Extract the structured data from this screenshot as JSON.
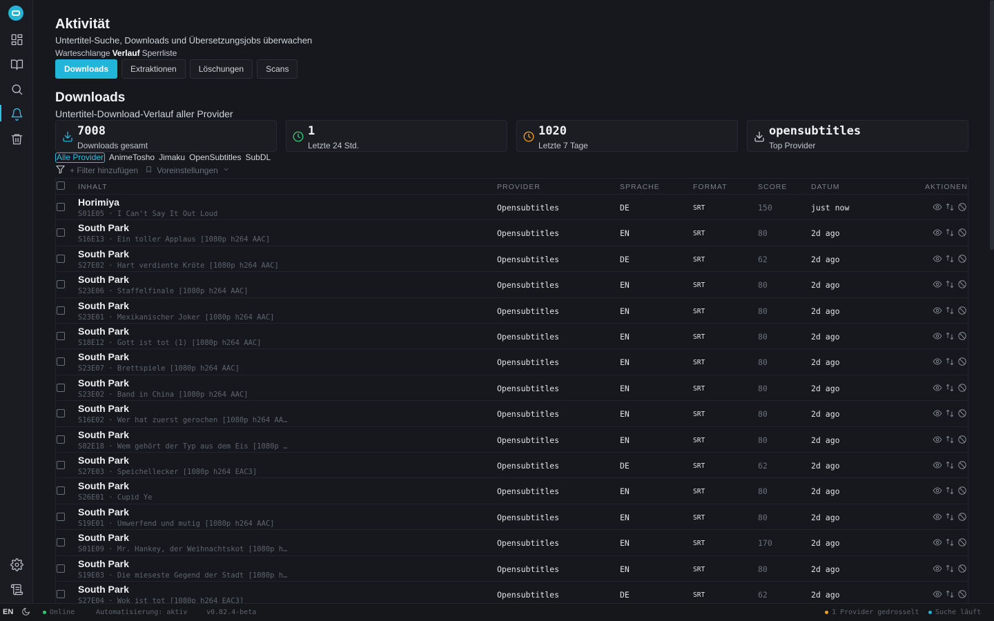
{
  "page": {
    "title": "Aktivität",
    "subtitle": "Untertitel-Suche, Downloads und Übersetzungsjobs überwachen",
    "subnav": [
      "Warteschlange",
      "Verlauf",
      "Sperrliste"
    ],
    "tabs": [
      "Downloads",
      "Extraktionen",
      "Löschungen",
      "Scans"
    ]
  },
  "section": {
    "title": "Downloads",
    "subtitle": "Untertitel-Download-Verlauf aller Provider"
  },
  "stats": [
    {
      "value": "7008",
      "label": "Downloads gesamt",
      "icon": "download-icon",
      "color": "#25b4d6"
    },
    {
      "value": "1",
      "label": "Letzte 24 Std.",
      "icon": "clock-icon",
      "color": "#2ecc71"
    },
    {
      "value": "1020",
      "label": "Letzte 7 Tage",
      "icon": "clock-icon",
      "color": "#f0a020"
    },
    {
      "value": "opensubtitles",
      "label": "Top Provider",
      "icon": "download-icon",
      "color": "#c9cdd3"
    }
  ],
  "providers": [
    "Alle Provider",
    "AnimeTosho",
    "Jimaku",
    "OpenSubtitles",
    "SubDL"
  ],
  "filters": {
    "add": "+ Filter hinzufügen",
    "presets": "Voreinstellungen"
  },
  "table": {
    "columns": [
      "INHALT",
      "PROVIDER",
      "SPRACHE",
      "FORMAT",
      "SCORE",
      "DATUM",
      "AKTIONEN"
    ],
    "rows": [
      {
        "title": "Horimiya",
        "episode": "S01E05 · I Can't Say It Out Loud",
        "provider": "Opensubtitles",
        "lang": "DE",
        "format": "SRT",
        "score": "150",
        "date": "just now"
      },
      {
        "title": "South Park",
        "episode": "S16E13 · Ein toller Applaus [1080p h264 AAC]",
        "provider": "Opensubtitles",
        "lang": "EN",
        "format": "SRT",
        "score": "80",
        "date": "2d ago"
      },
      {
        "title": "South Park",
        "episode": "S27E02 · Hart verdiente Kröte [1080p h264 AAC]",
        "provider": "Opensubtitles",
        "lang": "DE",
        "format": "SRT",
        "score": "62",
        "date": "2d ago"
      },
      {
        "title": "South Park",
        "episode": "S23E06 · Staffelfinale [1080p h264 AAC]",
        "provider": "Opensubtitles",
        "lang": "EN",
        "format": "SRT",
        "score": "80",
        "date": "2d ago"
      },
      {
        "title": "South Park",
        "episode": "S23E01 · Mexikanischer Joker [1080p h264 AAC]",
        "provider": "Opensubtitles",
        "lang": "EN",
        "format": "SRT",
        "score": "80",
        "date": "2d ago"
      },
      {
        "title": "South Park",
        "episode": "S18E12 · Gott ist tot (1) [1080p h264 AAC]",
        "provider": "Opensubtitles",
        "lang": "EN",
        "format": "SRT",
        "score": "80",
        "date": "2d ago"
      },
      {
        "title": "South Park",
        "episode": "S23E07 · Brettspiele [1080p h264 AAC]",
        "provider": "Opensubtitles",
        "lang": "EN",
        "format": "SRT",
        "score": "80",
        "date": "2d ago"
      },
      {
        "title": "South Park",
        "episode": "S23E02 · Band in China [1080p h264 AAC]",
        "provider": "Opensubtitles",
        "lang": "EN",
        "format": "SRT",
        "score": "80",
        "date": "2d ago"
      },
      {
        "title": "South Park",
        "episode": "S16E02 · Wer hat zuerst gerochen [1080p h264 AA…",
        "provider": "Opensubtitles",
        "lang": "EN",
        "format": "SRT",
        "score": "80",
        "date": "2d ago"
      },
      {
        "title": "South Park",
        "episode": "S02E18 · Wem gehört der Typ aus dem Eis [1080p …",
        "provider": "Opensubtitles",
        "lang": "EN",
        "format": "SRT",
        "score": "80",
        "date": "2d ago"
      },
      {
        "title": "South Park",
        "episode": "S27E03 · Speichellecker [1080p h264 EAC3]",
        "provider": "Opensubtitles",
        "lang": "DE",
        "format": "SRT",
        "score": "62",
        "date": "2d ago"
      },
      {
        "title": "South Park",
        "episode": "S26E01 · Cupid Ye",
        "provider": "Opensubtitles",
        "lang": "EN",
        "format": "SRT",
        "score": "80",
        "date": "2d ago"
      },
      {
        "title": "South Park",
        "episode": "S19E01 · Umwerfend und mutig [1080p h264 AAC]",
        "provider": "Opensubtitles",
        "lang": "EN",
        "format": "SRT",
        "score": "80",
        "date": "2d ago"
      },
      {
        "title": "South Park",
        "episode": "S01E09 · Mr. Hankey, der Weihnachtskot [1080p h…",
        "provider": "Opensubtitles",
        "lang": "EN",
        "format": "SRT",
        "score": "170",
        "date": "2d ago"
      },
      {
        "title": "South Park",
        "episode": "S19E03 · Die mieseste Gegend der Stadt [1080p h…",
        "provider": "Opensubtitles",
        "lang": "EN",
        "format": "SRT",
        "score": "80",
        "date": "2d ago"
      },
      {
        "title": "South Park",
        "episode": "S27E04 · Wok ist tot [1080p h264 EAC3]",
        "provider": "Opensubtitles",
        "lang": "DE",
        "format": "SRT",
        "score": "62",
        "date": "2d ago"
      }
    ]
  },
  "footer": {
    "lang": "EN",
    "online": "Online",
    "automation": "Automatisierung: aktiv",
    "version": "v0.82.4-beta",
    "throttled": "1 Provider gedrosselt",
    "search": "Suche läuft"
  },
  "colors": {
    "accent": "#22b5da",
    "online": "#2ecc71",
    "warning": "#f0a020"
  }
}
